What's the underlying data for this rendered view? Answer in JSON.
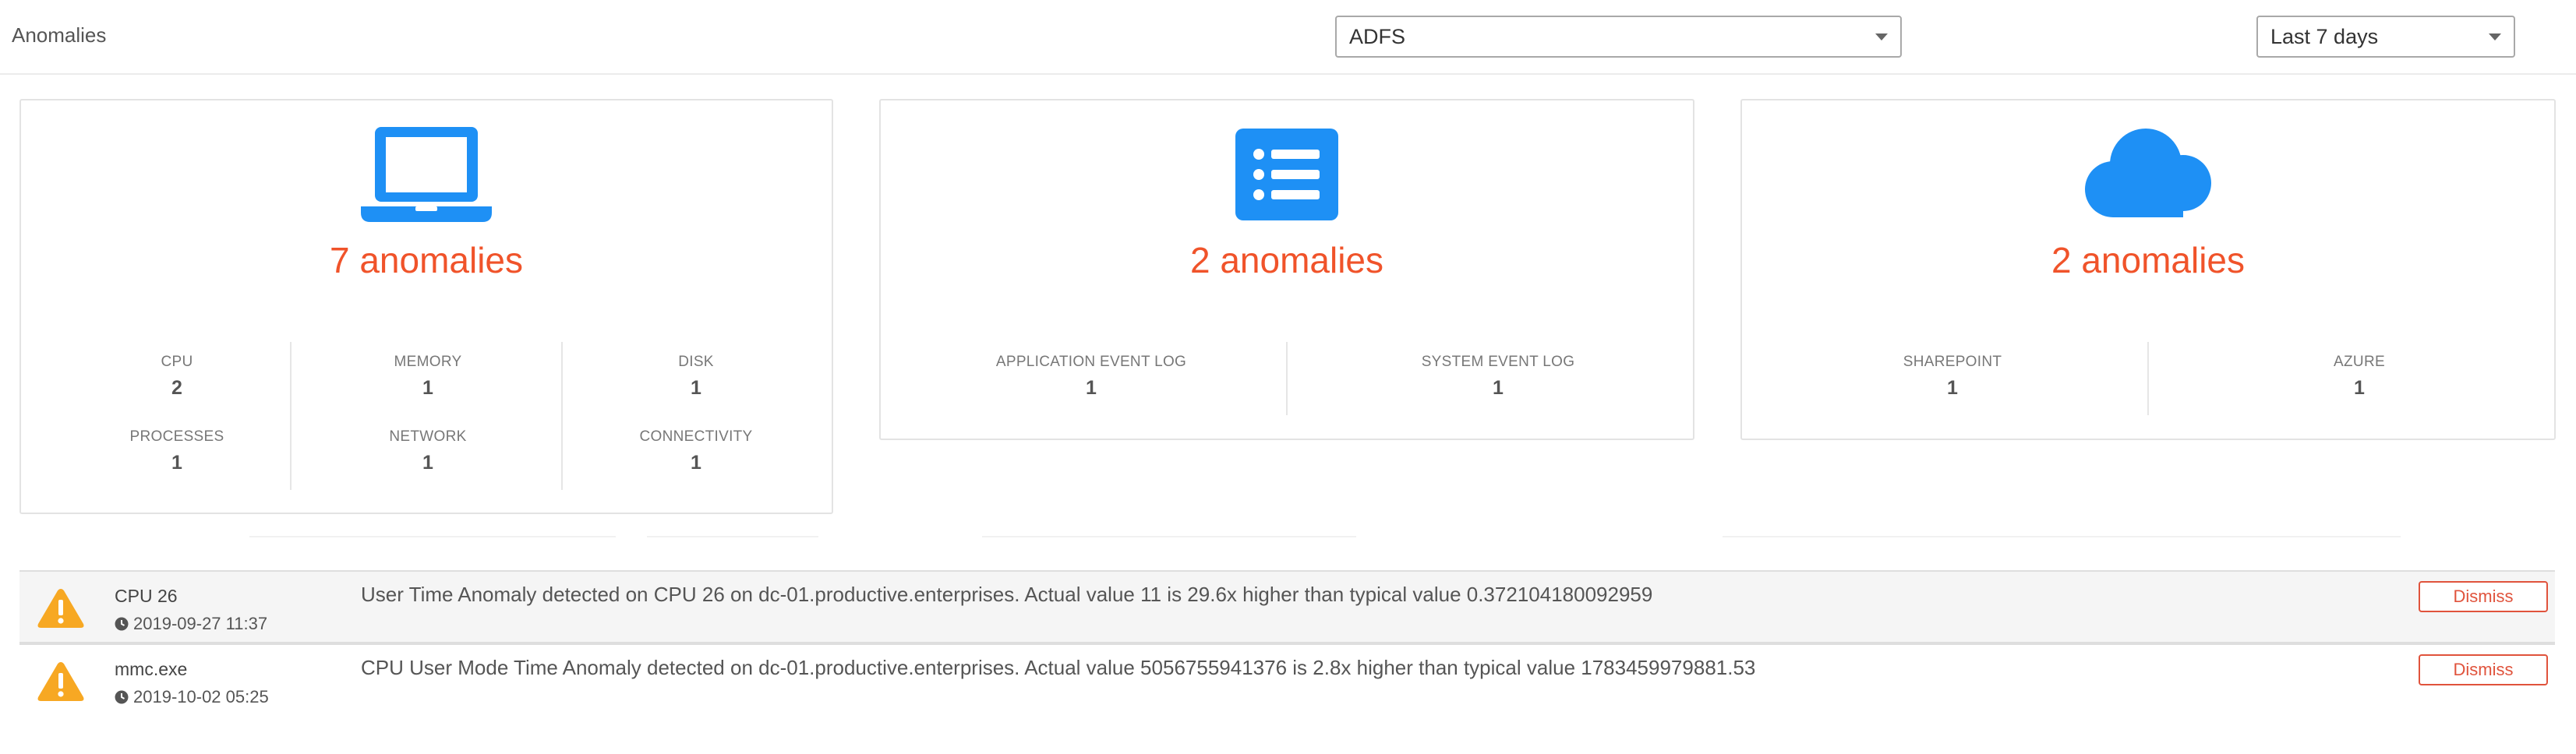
{
  "header": {
    "title": "Anomalies",
    "source_select": {
      "value": "ADFS"
    },
    "range_select": {
      "value": "Last 7 days"
    }
  },
  "cards": {
    "host": {
      "icon": "laptop-icon",
      "count_label": "7 anomalies",
      "metrics": [
        {
          "label": "CPU",
          "value": "2"
        },
        {
          "label": "MEMORY",
          "value": "1"
        },
        {
          "label": "DISK",
          "value": "1"
        },
        {
          "label": "PROCESSES",
          "value": "1"
        },
        {
          "label": "NETWORK",
          "value": "1"
        },
        {
          "label": "CONNECTIVITY",
          "value": "1"
        }
      ]
    },
    "events": {
      "icon": "list-icon",
      "count_label": "2 anomalies",
      "metrics": [
        {
          "label": "APPLICATION EVENT LOG",
          "value": "1"
        },
        {
          "label": "SYSTEM EVENT LOG",
          "value": "1"
        }
      ]
    },
    "apps": {
      "icon": "cloud-icon",
      "count_label": "2 anomalies",
      "metrics": [
        {
          "label": "SHAREPOINT",
          "value": "1"
        },
        {
          "label": "AZURE",
          "value": "1"
        }
      ]
    }
  },
  "alerts": [
    {
      "icon": "warning-icon",
      "name": "CPU 26",
      "time": "2019-09-27 11:37",
      "message": "User Time Anomaly detected on CPU 26 on dc-01.productive.enterprises. Actual value 11 is 29.6x higher than typical value 0.372104180092959",
      "dismiss_label": "Dismiss"
    },
    {
      "icon": "warning-icon",
      "name": "mmc.exe",
      "time": "2019-10-02 05:25",
      "message": "CPU User Mode Time Anomaly detected on dc-01.productive.enterprises. Actual value 5056755941376 is 2.8x higher than typical value 1783459979881.53",
      "dismiss_label": "Dismiss"
    }
  ],
  "colors": {
    "accent_blue": "#1e90f5",
    "anomaly_orange": "#f0532a",
    "warning_amber": "#f7a823",
    "dismiss_red": "#e0533c"
  }
}
